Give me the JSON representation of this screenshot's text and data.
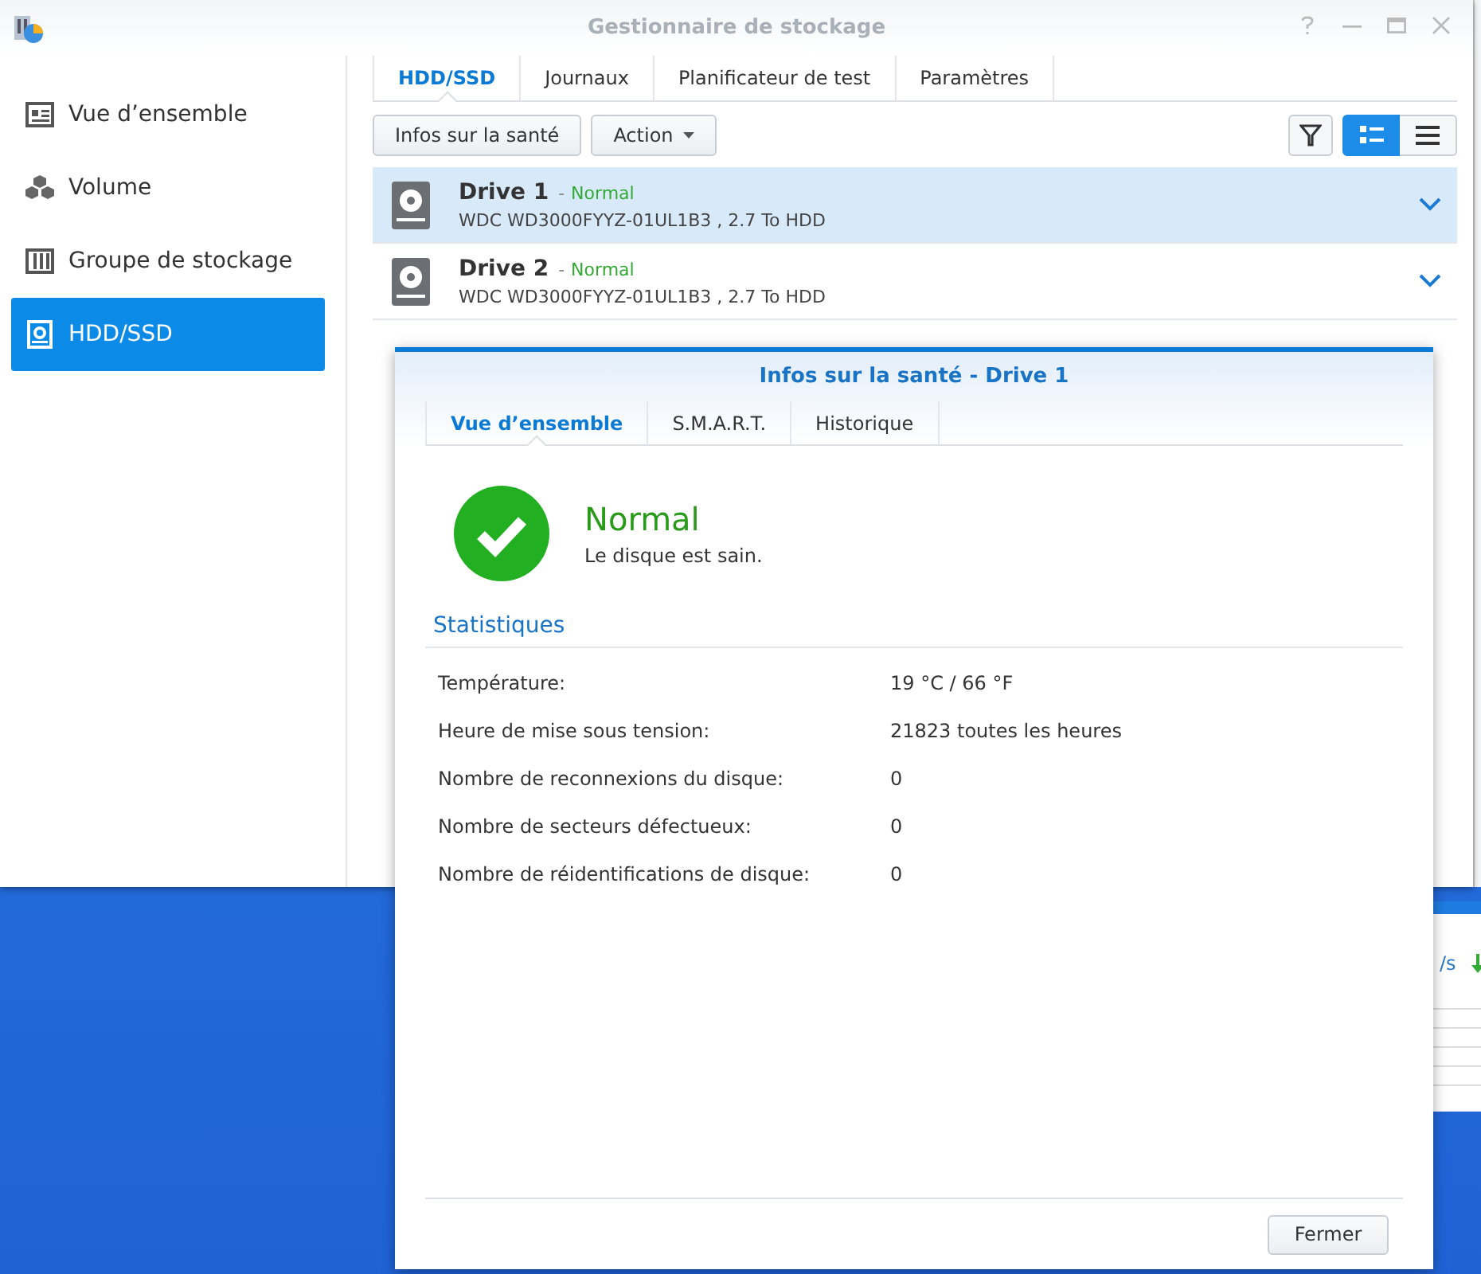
{
  "window": {
    "title": "Gestionnaire de stockage"
  },
  "sidebar": {
    "items": [
      {
        "label": "Vue d’ensemble",
        "selected": false
      },
      {
        "label": "Volume",
        "selected": false
      },
      {
        "label": "Groupe de stockage",
        "selected": false
      },
      {
        "label": "HDD/SSD",
        "selected": true
      }
    ]
  },
  "tabs": [
    {
      "label": "HDD/SSD",
      "selected": true
    },
    {
      "label": "Journaux",
      "selected": false
    },
    {
      "label": "Planificateur de test",
      "selected": false
    },
    {
      "label": "Paramètres",
      "selected": false
    }
  ],
  "toolbar": {
    "buttons": [
      {
        "label": "Infos sur la santé",
        "kind": "plain"
      },
      {
        "label": "Action",
        "kind": "menu"
      }
    ],
    "view_modes": [
      {
        "selected": true
      },
      {
        "selected": false
      }
    ]
  },
  "drives": [
    {
      "name": "Drive 1",
      "separator": "-",
      "status": "Normal",
      "detail": "WDC WD3000FYYZ-01UL1B3 , 2.7 To HDD",
      "selected": true
    },
    {
      "name": "Drive 2",
      "separator": "-",
      "status": "Normal",
      "detail": "WDC WD3000FYYZ-01UL1B3 , 2.7 To HDD",
      "selected": false
    }
  ],
  "dialog": {
    "title": "Infos sur la santé - Drive 1",
    "tabs": [
      {
        "label": "Vue d’ensemble",
        "selected": true
      },
      {
        "label": "S.M.A.R.T.",
        "selected": false
      },
      {
        "label": "Historique",
        "selected": false
      }
    ],
    "status": {
      "title": "Normal",
      "message": "Le disque est sain."
    },
    "section_title": "Statistiques",
    "stats": [
      {
        "label": "Température:",
        "value": "19 °C / 66 °F"
      },
      {
        "label": "Heure de mise sous tension:",
        "value": "21823 toutes les heures"
      },
      {
        "label": "Nombre de reconnexions du disque:",
        "value": "0"
      },
      {
        "label": "Nombre de secteurs défectueux:",
        "value": "0"
      },
      {
        "label": "Nombre de réidentifications de disque:",
        "value": "0"
      }
    ],
    "buttons": [
      "Fermer"
    ]
  },
  "background_window": {
    "text": "/s"
  }
}
